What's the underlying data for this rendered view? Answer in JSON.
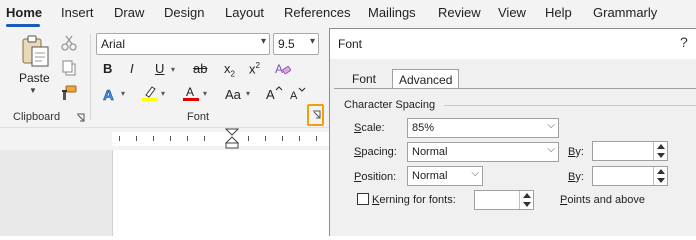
{
  "menu": {
    "tabs": [
      "Home",
      "Insert",
      "Draw",
      "Design",
      "Layout",
      "References",
      "Mailings",
      "Review",
      "View",
      "Help",
      "Grammarly"
    ]
  },
  "ribbon": {
    "clipboard": {
      "paste_label": "Paste",
      "group_label": "Clipboard"
    },
    "font": {
      "font_name": "Arial",
      "font_size": "9.5",
      "group_label": "Font",
      "bold": "B",
      "italic": "I",
      "underline": "U",
      "strikethrough": "ab",
      "subscript": "x",
      "subscript_mark": "2",
      "superscript": "x",
      "superscript_mark": "2",
      "change_case": "Aa"
    }
  },
  "dialog": {
    "title": "Font",
    "help": "?",
    "tabs": [
      "Font",
      "Advanced"
    ],
    "selected_tab": "Advanced",
    "section_title": "Character Spacing",
    "scale": {
      "label_u": "S",
      "label_rest": "cale:",
      "value": "85%"
    },
    "spacing": {
      "label_u": "S",
      "label_rest": "pacing:",
      "value": "Normal",
      "by_u": "B",
      "by_rest": "y:"
    },
    "position": {
      "label_u": "P",
      "label_rest": "osition:",
      "value": "Normal",
      "by_u": "B",
      "by_rest": "y:"
    },
    "kerning": {
      "label_u": "K",
      "label_rest": "erning for fonts:",
      "after_u": "P",
      "after_rest": "oints and above"
    }
  },
  "colors": {
    "accent": "#185abd",
    "highlight_yellow": "#ffff00",
    "font_color_red": "#e00000",
    "launcher_highlight": "#f59e0b"
  }
}
